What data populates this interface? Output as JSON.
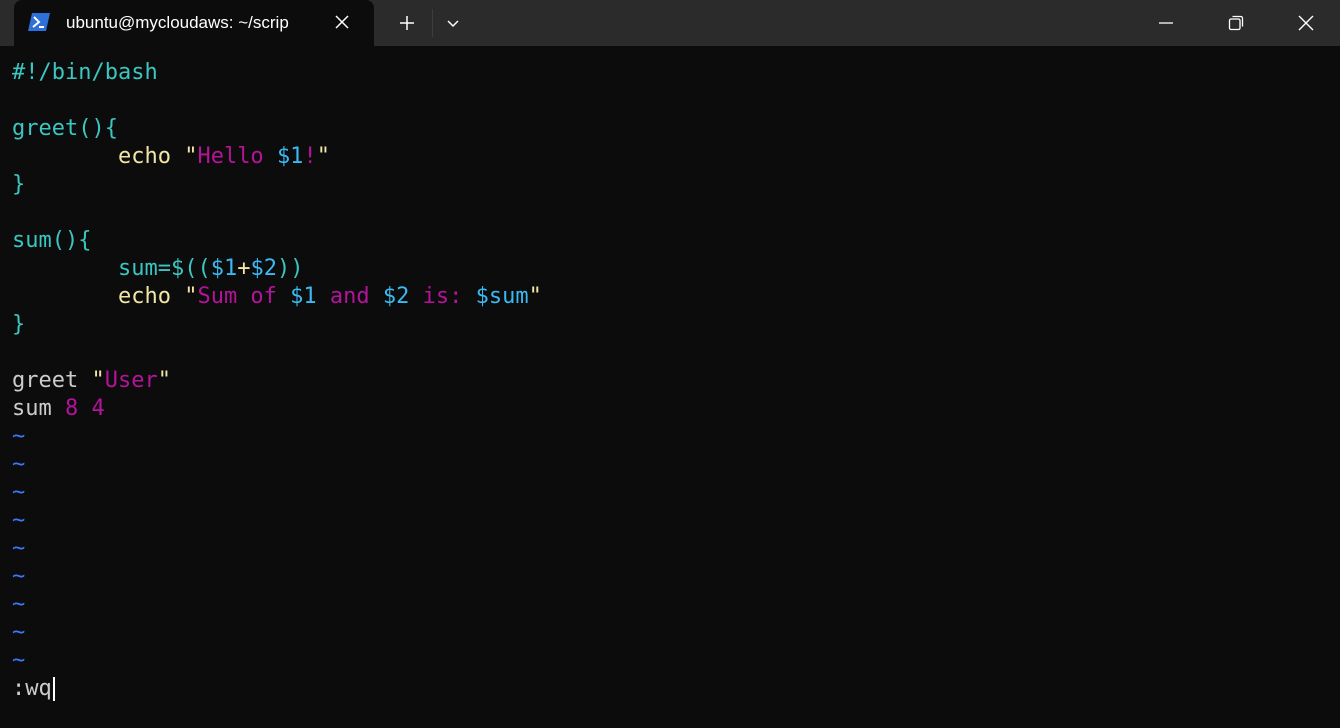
{
  "window": {
    "tab_title": "ubuntu@mycloudaws: ~/scrip",
    "tab_icon": "powershell-icon",
    "new_tab_icon": "plus-icon",
    "dropdown_icon": "chevron-down-icon",
    "controls": [
      "minimize-icon",
      "restore-icon",
      "close-icon"
    ]
  },
  "colors": {
    "background": "#0c0c0c",
    "titlebar": "#2b2b2b",
    "keyword_cyan": "#3cc6c0",
    "builtin_yellow": "#f2e6a6",
    "string_magenta": "#b4139a",
    "variable_blue": "#3ab9f2",
    "tilde_blue": "#3b78ff"
  },
  "editor": {
    "shebang": "#!/bin/bash",
    "greet_def": "greet(){",
    "echo_kw": "echo",
    "quote_open": "\"",
    "hello_text": "Hello ",
    "var_1": "$1",
    "bang": "!",
    "quote_close": "\"",
    "close_brace": "}",
    "sum_def": "sum(){",
    "sum_assign": "sum=",
    "arith_open": "$((",
    "plus": "+",
    "var_2": "$2",
    "arith_close": "))",
    "sum_of": "Sum of ",
    "and": " and ",
    "is": " is: ",
    "var_sum": "$sum",
    "call_greet": "greet ",
    "user_arg": "User",
    "call_sum": "sum ",
    "sum_args": "8 4",
    "tilde": "~",
    "command_line": ":wq"
  }
}
